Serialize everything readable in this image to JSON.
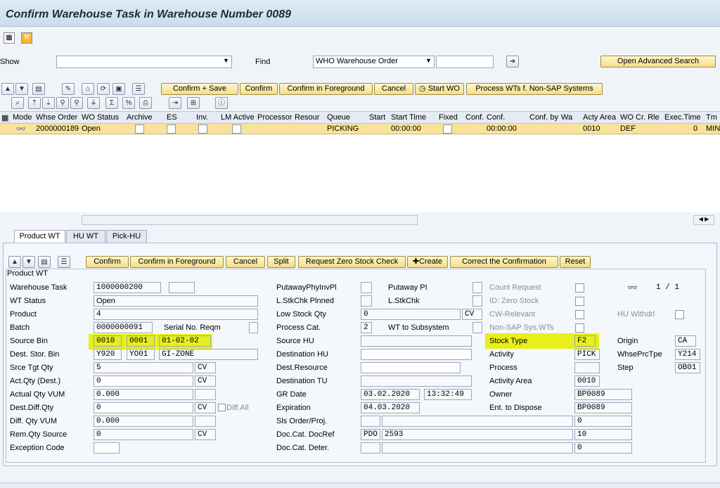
{
  "window": {
    "title": "Confirm Warehouse Task in Warehouse Number 0089"
  },
  "selection": {
    "show_label": "Show",
    "show_value": "",
    "find_label": "Find",
    "find_value": "WHO Warehouse Order",
    "find_input": "",
    "advanced_search": "Open Advanced Search"
  },
  "top_toolbar": {
    "confirm_save": "Confirm + Save",
    "confirm": "Confirm",
    "confirm_foreground": "Confirm in Foreground",
    "cancel": "Cancel",
    "start_wo": "Start WO",
    "process_wts": "Process WTs f. Non-SAP Systems"
  },
  "grid": {
    "columns": [
      "Mode",
      "Whse Order",
      "WO Status",
      "Archive",
      "ES",
      "Inv.",
      "LM Active",
      "Processor",
      "Resour",
      "Queue",
      "Start",
      "Start Time",
      "Fixed",
      "Conf.",
      "Conf.",
      "Conf. by",
      "Wa",
      "Acty Area",
      "WO Cr. Rle",
      "Exec.Time",
      "Tm"
    ],
    "row": {
      "whse_order": "2000000189",
      "wo_status": "Open",
      "queue": "PICKING",
      "start_time": "00:00:00",
      "conf_time": "00:00:00",
      "acty_area": "0010",
      "wo_cr_rle": "DEF",
      "exec_time": "0",
      "tm": "MIN"
    }
  },
  "tabs": [
    "Product WT",
    "HU WT",
    "Pick-HU"
  ],
  "detail_toolbar": {
    "confirm": "Confirm",
    "confirm_foreground": "Confirm in Foreground",
    "cancel": "Cancel",
    "split": "Split",
    "request_zero": "Request Zero Stock Check",
    "create": "Create",
    "correct": "Correct the Confirmation",
    "reset": "Reset"
  },
  "group_title": "Product WT",
  "left": {
    "warehouse_task_label": "Warehouse Task",
    "warehouse_task": "1000000200",
    "wt_status_label": "WT Status",
    "wt_status": "Open",
    "product_label": "Product",
    "product": "4",
    "batch_label": "Batch",
    "batch": "0000000091",
    "serial_label": "Serial No. Reqm",
    "source_bin_label": "Source Bin",
    "source_bin_1": "0010",
    "source_bin_2": "0001",
    "source_bin_3": "01-02-02",
    "dest_bin_label": "Dest. Stor. Bin",
    "dest_bin_1": "Y920",
    "dest_bin_2": "YO01",
    "dest_bin_3": "GI-ZONE",
    "srce_tgt_label": "Srce Tgt Qty",
    "srce_tgt": "5",
    "srce_tgt_uom": "CV",
    "act_qty_label": "Act.Qty (Dest.)",
    "act_qty": "0",
    "act_qty_uom": "CV",
    "actual_vum_label": "Actual Qty VUM",
    "actual_vum": "0.000",
    "dest_diff_label": "Dest.Diff.Qty",
    "dest_diff": "0",
    "dest_diff_uom": "CV",
    "diff_all": "Diff.All",
    "diff_vum_label": "Diff. Qty VUM",
    "diff_vum": "0.000",
    "rem_qty_label": "Rem.Qty Source",
    "rem_qty": "0",
    "rem_qty_uom": "CV",
    "exception_label": "Exception Code"
  },
  "middle": {
    "putaway_phys_label": "PutawayPhyInvPl",
    "putaway_pi_label": "Putaway PI",
    "lstkchk_planned_label": "L.StkChk Plnned",
    "lstkchk_label": "L.StkChk",
    "low_stock_label": "Low Stock Qty",
    "low_stock": "0",
    "low_stock_uom": "CV",
    "process_cat_label": "Process Cat.",
    "process_cat": "2",
    "wt_subsystem_label": "WT to Subsystem",
    "source_hu_label": "Source HU",
    "dest_hu_label": "Destination HU",
    "dest_resource_label": "Dest.Resource",
    "dest_tu_label": "Destination TU",
    "gr_date_label": "GR Date",
    "gr_date": "03.02.2020",
    "gr_time": "13:32:49",
    "expiration_label": "Expiration",
    "expiration": "04.03.2020",
    "sls_order_label": "Sls Order/Proj.",
    "sls_order_2": "0",
    "doc_cat_ref_label": "Doc.Cat. DocRef",
    "doc_cat": "PDO",
    "doc_ref": "2593",
    "doc_item": "10",
    "doc_cat_deter_label": "Doc.Cat. Deter.",
    "doc_deter_2": "0"
  },
  "right": {
    "count_request_label": "Count Request",
    "zero_stock_label": "ID: Zero Stock",
    "cw_relevant_label": "CW-Relevant",
    "non_sap_label": "Non-SAP Sys.WTs",
    "stock_type_label": "Stock Type",
    "stock_type": "F2",
    "activity_label": "Activity",
    "activity": "PICK",
    "process_label": "Process",
    "activity_area_label": "Activity Area",
    "activity_area": "0010",
    "owner_label": "Owner",
    "owner": "BP0089",
    "ent_dispose_label": "Ent. to Dispose",
    "ent_dispose": "BP0089",
    "pager": "1 / 1",
    "hu_withdrl_label": "HU Withdrl",
    "origin_label": "Origin",
    "origin": "CA",
    "whse_prc_label": "WhsePrcTpe",
    "whse_prc": "Y214",
    "step_label": "Step",
    "step": "OB01"
  }
}
